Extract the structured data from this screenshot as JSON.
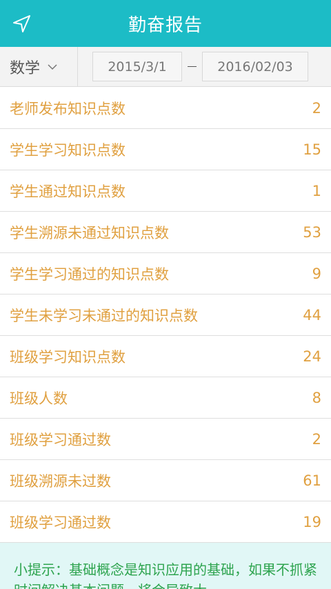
{
  "header": {
    "title": "勤奋报告",
    "back_icon": "navigation-arrow-icon"
  },
  "filter": {
    "subject": "数学",
    "start_date": "2015/3/1",
    "end_date": "2016/02/03"
  },
  "stats": [
    {
      "label": "老师发布知识点数",
      "value": "2"
    },
    {
      "label": "学生学习知识点数",
      "value": "15"
    },
    {
      "label": "学生通过知识点数",
      "value": "1"
    },
    {
      "label": "学生溯源未通过知识点数",
      "value": "53"
    },
    {
      "label": "学生学习通过的知识点数",
      "value": "9"
    },
    {
      "label": "学生未学习未通过的知识点数",
      "value": "44"
    },
    {
      "label": "班级学习知识点数",
      "value": "24"
    },
    {
      "label": "班级人数",
      "value": "8"
    },
    {
      "label": "班级学习通过数",
      "value": "2"
    },
    {
      "label": "班级溯源未过数",
      "value": "61"
    },
    {
      "label": "班级学习通过数",
      "value": "19"
    }
  ],
  "tip": {
    "text": "小提示：基础概念是知识应用的基础，如果不抓紧时间解决基本问题，将会导致大"
  },
  "colors": {
    "header_bg": "#1cbcc6",
    "row_text": "#e0a040",
    "tip_bg": "#e1f7f6",
    "tip_text": "#2ea44f"
  }
}
